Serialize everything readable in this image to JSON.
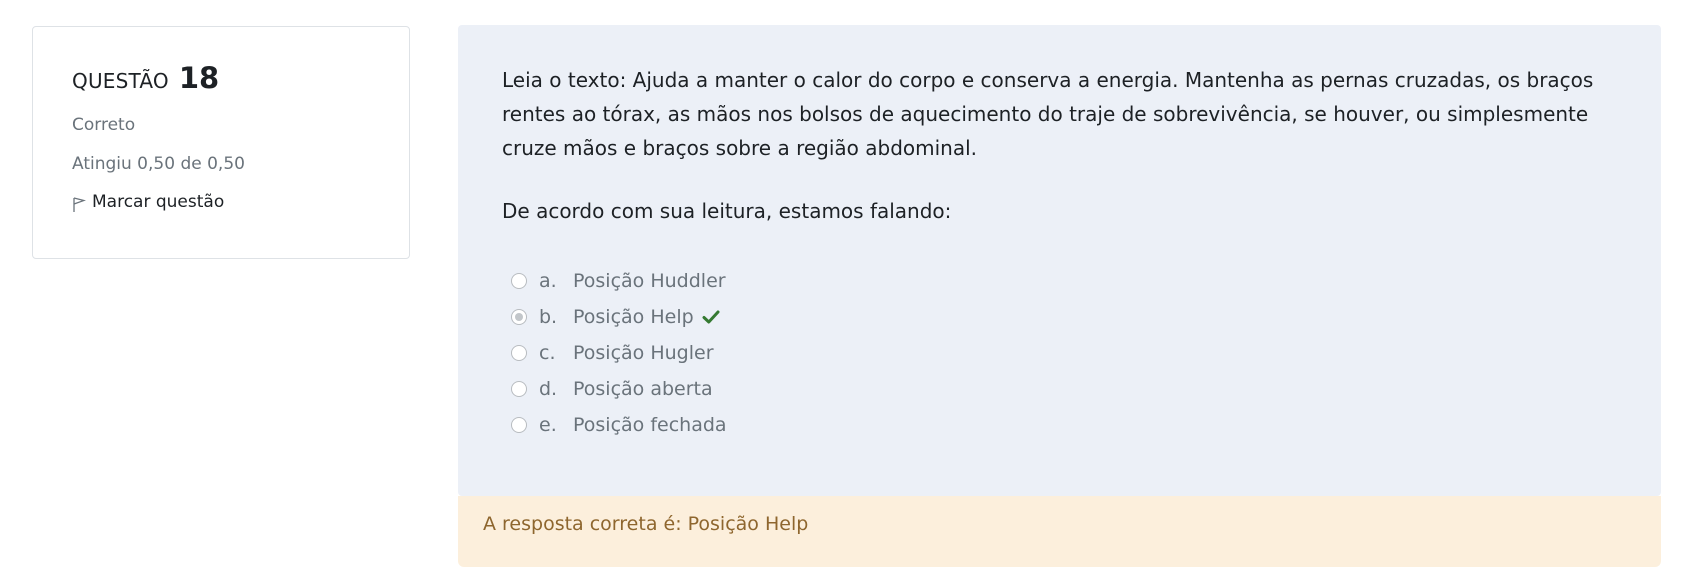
{
  "info": {
    "question_label": "QUESTÃO",
    "question_number": "18",
    "state": "Correto",
    "grade": "Atingiu 0,50 de 0,50",
    "flag_label": "Marcar questão"
  },
  "question": {
    "text": "Leia o texto: Ajuda a manter o calor do corpo e conserva a energia. Mantenha as pernas cruzadas, os braços rentes ao tórax, as mãos nos bolsos de aquecimento do traje de sobrevivência, se houver, ou simplesmente cruze mãos e braços sobre a região abdominal.",
    "prompt": "De acordo com sua leitura, estamos falando:",
    "options": [
      {
        "letter": "a.",
        "label": "Posição Huddler",
        "selected": false,
        "correct": false
      },
      {
        "letter": "b.",
        "label": "Posição Help",
        "selected": true,
        "correct": true
      },
      {
        "letter": "c.",
        "label": "Posição Hugler",
        "selected": false,
        "correct": false
      },
      {
        "letter": "d.",
        "label": "Posição aberta",
        "selected": false,
        "correct": false
      },
      {
        "letter": "e.",
        "label": "Posição fechada",
        "selected": false,
        "correct": false
      }
    ]
  },
  "feedback": {
    "text": "A resposta correta é: Posição Help"
  },
  "colors": {
    "panel_bg": "#ecf0f7",
    "feedback_bg": "#fcefdc",
    "feedback_text": "#8e662e",
    "correct_check": "#357a32"
  }
}
